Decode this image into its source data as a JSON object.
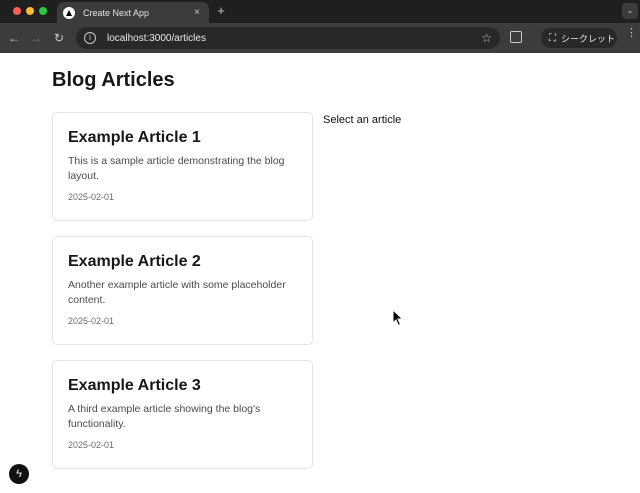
{
  "browser": {
    "tab_title": "Create Next App",
    "tab_close": "×",
    "new_tab": "+",
    "tab_menu": "⌄",
    "url": "localhost:3000/articles",
    "incognito_label": "シークレット",
    "icons": {
      "back": "←",
      "forward": "→",
      "reload": "↻",
      "site_info": "i",
      "star": "☆",
      "incognito": "⛶",
      "more": "⋮"
    },
    "colors": {
      "close": "#ff5f57",
      "minimize": "#febc2e",
      "maximize": "#28c840"
    }
  },
  "page": {
    "title": "Blog Articles",
    "select_prompt": "Select an article",
    "articles": [
      {
        "title": "Example Article 1",
        "excerpt": "This is a sample article demonstrating the blog layout.",
        "date": "2025-02-01"
      },
      {
        "title": "Example Article 2",
        "excerpt": "Another example article with some placeholder content.",
        "date": "2025-02-01"
      },
      {
        "title": "Example Article 3",
        "excerpt": "A third example article showing the blog's functionality.",
        "date": "2025-02-01"
      }
    ],
    "dev_badge_icon": "ϟ"
  }
}
